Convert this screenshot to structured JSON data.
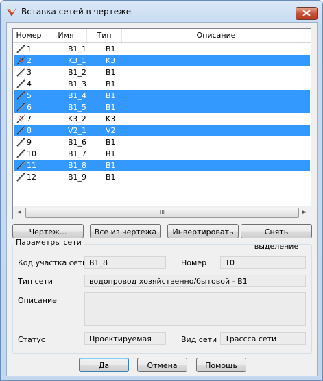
{
  "window": {
    "title": "Вставка сетей в чертеже"
  },
  "colors": {
    "selection": "#3399ff",
    "title_gradient": "#c9dcf2"
  },
  "icons": {
    "close": "close-icon",
    "app": "app-logo-icon",
    "pipe": "pipe-line-icon",
    "cable": "cable-line-icon"
  },
  "table": {
    "headers": [
      "Номер",
      "Имя",
      "Тип",
      "Описание"
    ],
    "rows": [
      {
        "num": "1",
        "name": "B1_1",
        "type": "B1",
        "desc": "",
        "icon": "pipe",
        "selected": false
      },
      {
        "num": "2",
        "name": "K3_1",
        "type": "K3",
        "desc": "",
        "icon": "cable",
        "selected": true
      },
      {
        "num": "3",
        "name": "B1_2",
        "type": "B1",
        "desc": "",
        "icon": "pipe",
        "selected": false
      },
      {
        "num": "4",
        "name": "B1_3",
        "type": "B1",
        "desc": "",
        "icon": "pipe",
        "selected": false
      },
      {
        "num": "5",
        "name": "B1_4",
        "type": "B1",
        "desc": "",
        "icon": "pipe",
        "selected": true
      },
      {
        "num": "6",
        "name": "B1_5",
        "type": "B1",
        "desc": "",
        "icon": "pipe",
        "selected": true
      },
      {
        "num": "7",
        "name": "K3_2",
        "type": "K3",
        "desc": "",
        "icon": "cable",
        "selected": false
      },
      {
        "num": "8",
        "name": "V2_1",
        "type": "V2",
        "desc": "",
        "icon": "pipe",
        "selected": true
      },
      {
        "num": "9",
        "name": "B1_6",
        "type": "B1",
        "desc": "",
        "icon": "pipe",
        "selected": false
      },
      {
        "num": "10",
        "name": "B1_7",
        "type": "B1",
        "desc": "",
        "icon": "pipe",
        "selected": false
      },
      {
        "num": "11",
        "name": "B1_8",
        "type": "B1",
        "desc": "",
        "icon": "pipe",
        "selected": true
      },
      {
        "num": "12",
        "name": "B1_9",
        "type": "B1",
        "desc": "",
        "icon": "pipe",
        "selected": false
      }
    ]
  },
  "scroll": {
    "left": "◄",
    "right": "►",
    "grip": "III"
  },
  "buttons": {
    "drawing": "Чертеж...",
    "all_from_drawing": "Все из чертежа",
    "invert": "Инвертировать",
    "clear_selection": "Снять выделение",
    "ok": "Да",
    "cancel": "Отмена",
    "help": "Помощь"
  },
  "params": {
    "group_title": "Параметры сети",
    "code_label": "Код участка сети",
    "code_value": "B1_8",
    "number_label": "Номер",
    "number_value": "10",
    "type_label": "Тип сети",
    "type_value": "водопровод хозяйственно/бытовой - B1",
    "desc_label": "Описание",
    "desc_value": "",
    "status_label": "Статус",
    "status_value": "Проектируемая",
    "view_label": "Вид сети",
    "view_value": "Трассса сети"
  }
}
